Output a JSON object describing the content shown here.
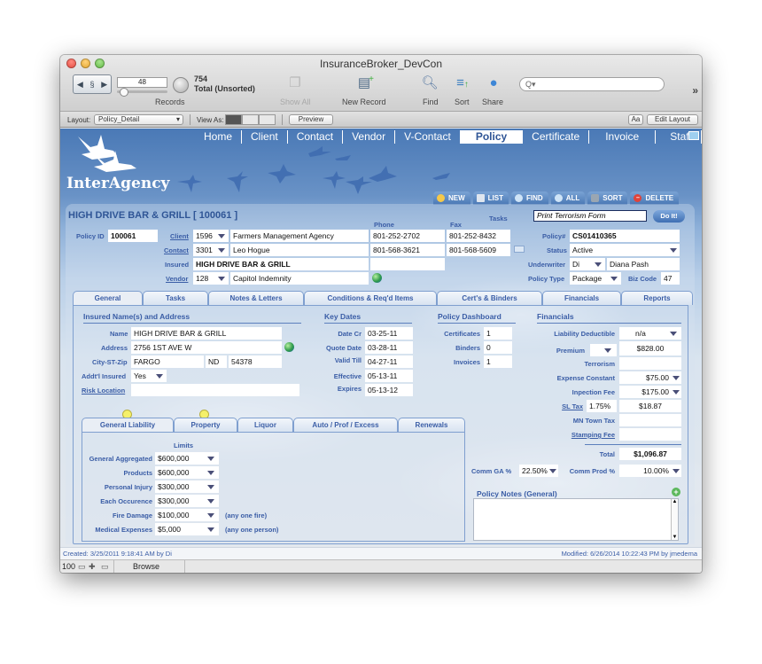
{
  "window": {
    "title": "InsuranceBroker_DevCon"
  },
  "toolbar": {
    "record_current": "48",
    "record_count": "754",
    "record_status": "Total (Unsorted)",
    "records_label": "Records",
    "show_all_label": "Show All",
    "new_record_label": "New Record",
    "find_label": "Find",
    "sort_label": "Sort",
    "share_label": "Share",
    "search_placeholder": "Q▾",
    "more_label": "»"
  },
  "layoutbar": {
    "layout_label": "Layout:",
    "layout_value": "Policy_Detail",
    "view_as_label": "View As:",
    "preview_label": "Preview",
    "text_size_label": "Aa",
    "edit_layout_label": "Edit Layout"
  },
  "nav": {
    "items": [
      "Home",
      "Client",
      "Contact",
      "Vendor",
      "V-Contact",
      "Policy",
      "Certificate",
      "Invoice",
      "Staff"
    ],
    "active": "Policy"
  },
  "logo": {
    "text": "InterAgency"
  },
  "actions": [
    {
      "label": "NEW",
      "icon": "new-icon",
      "color": "#f5c84a"
    },
    {
      "label": "LIST",
      "icon": "list-icon",
      "color": "#dfe6ef"
    },
    {
      "label": "FIND",
      "icon": "find-icon",
      "color": "#cfe4f7"
    },
    {
      "label": "ALL",
      "icon": "all-icon",
      "color": "#cfe4f7"
    },
    {
      "label": "SORT",
      "icon": "sort-icon",
      "color": "#9aa6b2"
    },
    {
      "label": "DELETE",
      "icon": "delete-icon",
      "color": "#e0433a"
    }
  ],
  "record": {
    "title": "HIGH DRIVE BAR & GRILL  [ 100061 ]",
    "tasks_label": "Tasks",
    "tasks_value": "Print Terrorism Form",
    "do_it_label": "Do It!",
    "policy_id_label": "Policy ID",
    "policy_id": "100061",
    "phone_header": "Phone",
    "fax_header": "Fax",
    "client_label": "Client",
    "client_id": "1596",
    "client_name": "Farmers Management Agency",
    "client_phone": "801-252-2702",
    "client_fax": "801-252-8432",
    "contact_label": "Contact",
    "contact_id": "3301",
    "contact_name": "Leo Hogue",
    "contact_phone": "801-568-3621",
    "contact_fax": "801-568-5609",
    "insured_label": "Insured",
    "insured_name": "HIGH DRIVE BAR & GRILL",
    "vendor_label": "Vendor",
    "vendor_id": "128",
    "vendor_name": "Capitol Indemnity",
    "policy_num_label": "Policy#",
    "policy_num": "CS01410365",
    "status_label": "Status",
    "status": "Active",
    "underwriter_label": "Underwriter",
    "underwriter_code": "Di",
    "underwriter_name": "Diana Pash",
    "policy_type_label": "Policy Type",
    "policy_type": "Package",
    "biz_code_label": "Biz Code",
    "biz_code": "47"
  },
  "main_tabs": [
    {
      "label": "General",
      "active": true
    },
    {
      "label": "Tasks"
    },
    {
      "label": "Notes & Letters"
    },
    {
      "label": "Conditions & Req'd Items"
    },
    {
      "label": "Cert's & Binders"
    },
    {
      "label": "Financials"
    },
    {
      "label": "Reports"
    }
  ],
  "insured": {
    "title": "Insured Name(s) and Address",
    "name_label": "Name",
    "name": "HIGH DRIVE BAR & GRILL",
    "address_label": "Address",
    "address": "2756 1ST AVE W",
    "csz_label": "City-ST-Zip",
    "city": "FARGO",
    "state": "ND",
    "zip": "54378",
    "addl_label": "Addt'l Insured",
    "addl": "Yes",
    "risk_label": "Risk Location",
    "risk": ""
  },
  "key_dates": {
    "title": "Key Dates",
    "items": [
      {
        "label": "Date Cr",
        "value": "03-25-11"
      },
      {
        "label": "Quote Date",
        "value": "03-28-11"
      },
      {
        "label": "Valid Till",
        "value": "04-27-11"
      },
      {
        "label": "Effective",
        "value": "05-13-11"
      },
      {
        "label": "Expires",
        "value": "05-13-12"
      }
    ]
  },
  "dashboard": {
    "title": "Policy Dashboard",
    "items": [
      {
        "label": "Certificates",
        "value": "1"
      },
      {
        "label": "Binders",
        "value": "0"
      },
      {
        "label": "Invoices",
        "value": "1"
      }
    ]
  },
  "financials": {
    "title": "Financials",
    "liability_deductible_label": "Liability Deductible",
    "liability_deductible": "n/a",
    "premium_label": "Premium",
    "premium": "$828.00",
    "terrorism_label": "Terrorism",
    "terrorism": "",
    "expense_label": "Expense Constant",
    "expense": "$75.00",
    "inspection_label": "Inpection Fee",
    "inspection": "$175.00",
    "sl_tax_label": "SL Tax",
    "sl_tax_rate": "1.75%",
    "sl_tax": "$18.87",
    "mn_town_label": "MN Town Tax",
    "mn_town": "",
    "stamping_label": "Stamping Fee",
    "stamping": "",
    "total_label": "Total",
    "total": "$1,096.87",
    "comm_ga_label": "Comm GA %",
    "comm_ga": "22.50%",
    "comm_prod_label": "Comm Prod %",
    "comm_prod": "10.00%"
  },
  "coverage_tabs": [
    {
      "label": "General Liability",
      "active": true,
      "flag": true
    },
    {
      "label": "Property",
      "flag": true
    },
    {
      "label": "Liquor"
    },
    {
      "label": "Auto / Prof / Excess"
    },
    {
      "label": "Renewals"
    }
  ],
  "limits": {
    "header": "Limits",
    "items": [
      {
        "label": "General Aggregated",
        "value": "$600,000",
        "note": ""
      },
      {
        "label": "Products",
        "value": "$600,000",
        "note": ""
      },
      {
        "label": "Personal Injury",
        "value": "$300,000",
        "note": ""
      },
      {
        "label": "Each Occurence",
        "value": "$300,000",
        "note": ""
      },
      {
        "label": "Fire Damage",
        "value": "$100,000",
        "note": "(any one fire)"
      },
      {
        "label": "Medical Expenses",
        "value": "$5,000",
        "note": "(any one person)"
      }
    ]
  },
  "notes": {
    "title": "Policy Notes (General)",
    "value": ""
  },
  "footer": {
    "created": "Created: 3/25/2011 9:18:41 AM by Di",
    "modified": "Modified: 6/26/2014 10:22:43 PM by jmedema"
  },
  "statusbar": {
    "zoom": "100",
    "mode": "Browse"
  }
}
